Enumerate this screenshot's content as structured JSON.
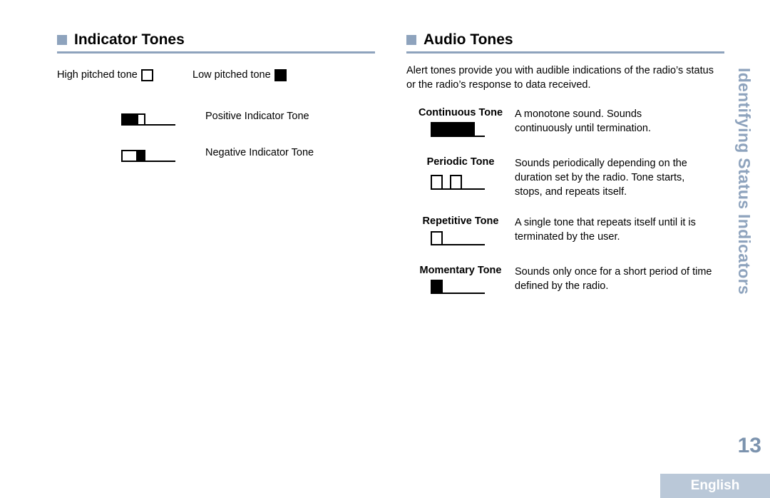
{
  "indicator_tones": {
    "title": "Indicator Tones",
    "legend": {
      "high_label": "High pitched tone",
      "low_label": "Low pitched tone"
    },
    "items": [
      {
        "label": "Positive Indicator Tone",
        "pattern": [
          "low",
          "high"
        ]
      },
      {
        "label": "Negative Indicator Tone",
        "pattern": [
          "high",
          "low"
        ]
      }
    ]
  },
  "audio_tones": {
    "title": "Audio Tones",
    "intro": "Alert tones provide you with audible indications of the radio’s status or the radio’s response to data received.",
    "items": [
      {
        "name": "Continuous Tone",
        "description": "A monotone sound. Sounds continuously until termination."
      },
      {
        "name": "Periodic Tone",
        "description": "Sounds periodically depending on the duration set by the radio. Tone starts, stops, and repeats itself."
      },
      {
        "name": "Repetitive Tone",
        "description": "A single tone that repeats itself until it is terminated by the user."
      },
      {
        "name": "Momentary Tone",
        "description": "Sounds only once for a short period of time defined by the radio."
      }
    ]
  },
  "sidebar": {
    "chapter_title": "Identifying Status Indicators",
    "page_number": "13",
    "language_tab": "English"
  },
  "colors": {
    "accent": "#8ea3bd",
    "page_number": "#7c93ae",
    "language_tab_bg": "#bac8d8"
  }
}
